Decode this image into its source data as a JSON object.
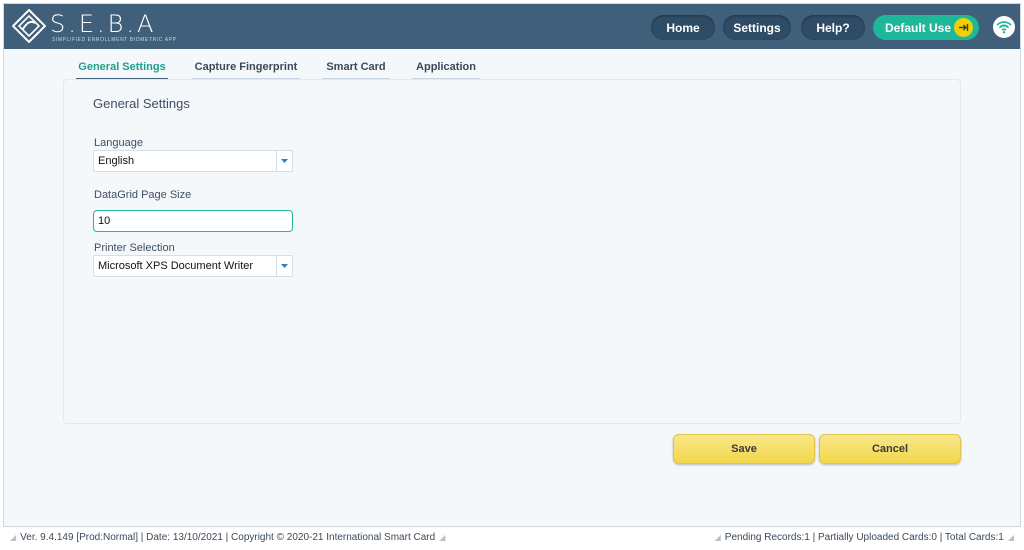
{
  "header": {
    "logo_text": "S.E.B.A",
    "logo_subtitle": "SIMPLIFIED ENROLLMENT BIOMETRIC APP",
    "nav": [
      {
        "label": "Home"
      },
      {
        "label": "Settings"
      },
      {
        "label": "Help?"
      }
    ],
    "user_label": "Default Use",
    "accent_color": "#1fb79a",
    "header_color": "#3f5f7a"
  },
  "tabs": [
    {
      "label": "General Settings",
      "active": true
    },
    {
      "label": "Capture Fingerprint",
      "active": false
    },
    {
      "label": "Smart Card",
      "active": false
    },
    {
      "label": "Application",
      "active": false
    }
  ],
  "panel": {
    "title": "General Settings",
    "language": {
      "label": "Language",
      "value": "English"
    },
    "page_size": {
      "label": "DataGrid Page Size",
      "value": "10"
    },
    "printer": {
      "label": "Printer Selection",
      "value": "Microsoft XPS Document Writer"
    }
  },
  "actions": {
    "save_label": "Save",
    "cancel_label": "Cancel"
  },
  "status": {
    "left": "Ver. 9.4.149 [Prod:Normal] | Date: 13/10/2021 | Copyright © 2020-21 International Smart Card",
    "right": "Pending Records:1 | Partially Uploaded Cards:0 | Total Cards:1"
  }
}
